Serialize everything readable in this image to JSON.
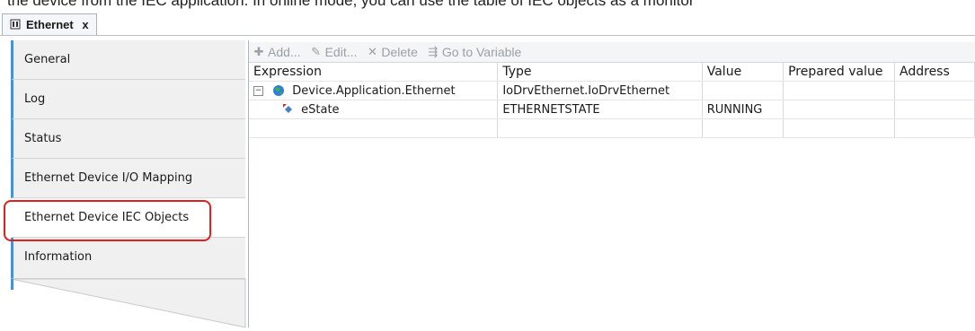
{
  "document": {
    "text": "the device from the IEC application. In online mode, you can use the table of IEC objects as a monitor"
  },
  "tab": {
    "title": "Ethernet",
    "close": "x"
  },
  "sidebar": {
    "items": [
      {
        "label": "General"
      },
      {
        "label": "Log"
      },
      {
        "label": "Status"
      },
      {
        "label": "Ethernet Device I/O Mapping"
      },
      {
        "label": "Ethernet Device IEC Objects"
      },
      {
        "label": "Information"
      }
    ],
    "active_index": 4,
    "highlight_color": "#e0201c"
  },
  "toolbar": {
    "add": "Add...",
    "edit": "Edit...",
    "delete": "Delete",
    "goto": "Go to Variable"
  },
  "table": {
    "headers": [
      "Expression",
      "Type",
      "Value",
      "Prepared value",
      "Address"
    ],
    "rows": [
      {
        "expression": "Device.Application.Ethernet",
        "type": "IoDrvEthernet.IoDrvEthernet",
        "value": "",
        "prepared": "",
        "address": ""
      },
      {
        "expression": "eState",
        "type": "ETHERNETSTATE",
        "value": "RUNNING",
        "prepared": "",
        "address": ""
      }
    ]
  },
  "icons": {
    "tab": "device-tab-icon",
    "add": "plus-icon",
    "edit": "edit-icon",
    "delete": "x-delete-icon",
    "goto": "goto-variable-icon",
    "tree": "collapse-minus-icon",
    "device": "globe-device-icon",
    "variable": "variable-icon"
  }
}
